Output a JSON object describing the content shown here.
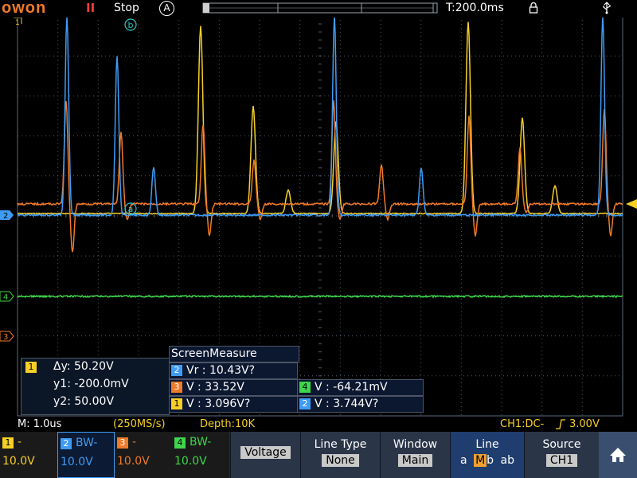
{
  "top_bar": {
    "logo": "owon",
    "pause_glyph": "II",
    "run_state": "Stop",
    "trigger_mode": "A",
    "timebase": "T:200.0ms",
    "icons": [
      "lock-icon",
      "usb-icon"
    ]
  },
  "markers": {
    "b": "b",
    "a": "a",
    "ch1_marker": "1",
    "ch2_marker": "2",
    "ch4_marker": "4",
    "ch3_marker": "3"
  },
  "cursor": {
    "channel": "1",
    "delta_y": "Δy: 50.20V",
    "y1": "y1: -200.0mV",
    "y2": "y2: 50.00V"
  },
  "screen_measure": {
    "title": "ScreenMeasure",
    "rows": [
      {
        "channel": "2",
        "text": "Vr : 10.43V?"
      },
      {
        "channel": "3",
        "text": "V : 33.52V"
      },
      {
        "channel": "1",
        "text": "V : 3.096V?"
      }
    ],
    "extra": [
      {
        "channel": "4",
        "text": "V : -64.21mV"
      },
      {
        "channel": "2",
        "text": "V : 3.744V?"
      }
    ]
  },
  "status_bar": {
    "timescale": "M: 1.0us",
    "sample_rate": "(250MS/s)",
    "depth": "Depth:10K",
    "trigger": "CH1:DC-",
    "trigger_level": "3.00V"
  },
  "channels": [
    {
      "num": "1",
      "coupling": "-",
      "scale": "10.0V",
      "color": "#f6cf27"
    },
    {
      "num": "2",
      "coupling": "BW-",
      "scale": "10.0V",
      "color": "#3f9cf5"
    },
    {
      "num": "3",
      "coupling": "-",
      "scale": "10.0V",
      "color": "#f07a28"
    },
    {
      "num": "4",
      "coupling": "BW-",
      "scale": "10.0V",
      "color": "#3ed64a"
    }
  ],
  "menu": {
    "voltage": "Voltage",
    "line_type_title": "Line Type",
    "line_type_value": "None",
    "window_title": "Window",
    "window_value": "Main",
    "line_title": "Line",
    "line_options": [
      "a",
      "M",
      "b",
      "ab"
    ],
    "line_selected": "M",
    "source_title": "Source",
    "source_value": "CH1",
    "home_icon": "home-icon"
  },
  "colors": {
    "ch1": "#f6cf27",
    "ch2": "#3f9cf5",
    "ch3": "#f07a28",
    "ch4": "#3ed64a",
    "grid": "#5a6a7a"
  }
}
